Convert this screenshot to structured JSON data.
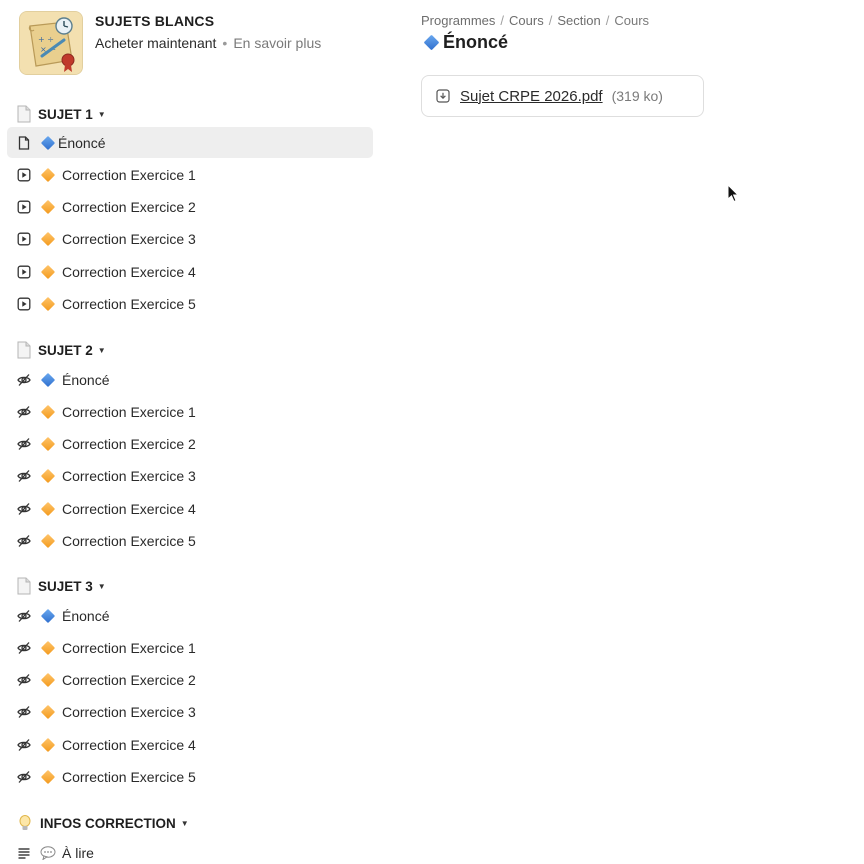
{
  "course": {
    "title": "SUJETS BLANCS",
    "buy_label": "Acheter maintenant",
    "separator": "•",
    "learn_more_label": "En savoir plus"
  },
  "breadcrumb": {
    "items": [
      "Programmes",
      "Cours",
      "Section",
      "Cours"
    ],
    "separator": "/"
  },
  "page": {
    "title": "Énoncé",
    "title_icon": "blue-diamond-icon"
  },
  "attachment": {
    "file_name": "Sujet CRPE 2026.pdf",
    "file_size": "(319 ko)",
    "icon": "download-icon"
  },
  "sections": [
    {
      "title": "SUJET 1",
      "icon": "document-emoji-icon",
      "lessons": [
        {
          "label": "Énoncé",
          "type_icon": "page-icon",
          "marker": "blue-diamond",
          "active": true
        },
        {
          "label": "Correction Exercice 1",
          "type_icon": "video-icon",
          "marker": "orange-diamond"
        },
        {
          "label": "Correction Exercice 2",
          "type_icon": "video-icon",
          "marker": "orange-diamond"
        },
        {
          "label": "Correction Exercice 3",
          "type_icon": "video-icon",
          "marker": "orange-diamond"
        },
        {
          "label": "Correction Exercice 4",
          "type_icon": "video-icon",
          "marker": "orange-diamond"
        },
        {
          "label": "Correction Exercice 5",
          "type_icon": "video-icon",
          "marker": "orange-diamond"
        }
      ]
    },
    {
      "title": "SUJET 2",
      "icon": "document-emoji-icon",
      "lessons": [
        {
          "label": "Énoncé",
          "type_icon": "eye-off-icon",
          "marker": "blue-diamond"
        },
        {
          "label": "Correction Exercice 1",
          "type_icon": "eye-off-icon",
          "marker": "orange-diamond"
        },
        {
          "label": "Correction Exercice 2",
          "type_icon": "eye-off-icon",
          "marker": "orange-diamond"
        },
        {
          "label": "Correction Exercice 3",
          "type_icon": "eye-off-icon",
          "marker": "orange-diamond"
        },
        {
          "label": "Correction Exercice 4",
          "type_icon": "eye-off-icon",
          "marker": "orange-diamond"
        },
        {
          "label": "Correction Exercice 5",
          "type_icon": "eye-off-icon",
          "marker": "orange-diamond"
        }
      ]
    },
    {
      "title": "SUJET 3",
      "icon": "document-emoji-icon",
      "lessons": [
        {
          "label": "Énoncé",
          "type_icon": "eye-off-icon",
          "marker": "blue-diamond"
        },
        {
          "label": "Correction Exercice 1",
          "type_icon": "eye-off-icon",
          "marker": "orange-diamond"
        },
        {
          "label": "Correction Exercice 2",
          "type_icon": "eye-off-icon",
          "marker": "orange-diamond"
        },
        {
          "label": "Correction Exercice 3",
          "type_icon": "eye-off-icon",
          "marker": "orange-diamond"
        },
        {
          "label": "Correction Exercice 4",
          "type_icon": "eye-off-icon",
          "marker": "orange-diamond"
        },
        {
          "label": "Correction Exercice 5",
          "type_icon": "eye-off-icon",
          "marker": "orange-diamond"
        }
      ]
    },
    {
      "title": "INFOS CORRECTION",
      "icon": "lightbulb-emoji-icon",
      "lessons": [
        {
          "label": "À lire",
          "type_icon": "text-lines-icon",
          "marker": "speech-bubble"
        }
      ]
    }
  ],
  "colors": {
    "active_row": "#eeeeee",
    "blue_marker": "#3b7dd8",
    "orange_marker": "#f5a623",
    "border": "#dedede"
  }
}
